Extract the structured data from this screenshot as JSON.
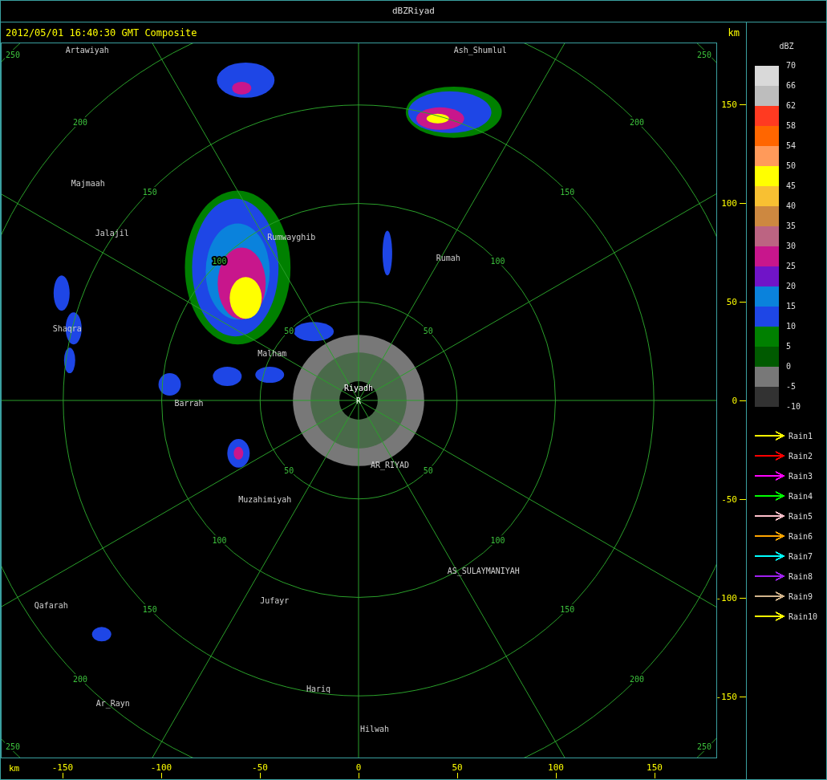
{
  "window": {
    "title": "dBZRiyad"
  },
  "header": {
    "timestamp": "2012/05/01 16:40:30 GMT Composite",
    "unit": "km"
  },
  "ppi": {
    "radar_site": {
      "name": "Riyadh",
      "marker": "R"
    },
    "range_rings": [
      {
        "labels": [
          "50",
          "50",
          "50",
          "50"
        ]
      },
      {
        "labels": [
          "100",
          "100",
          "100",
          "100"
        ]
      },
      {
        "labels": [
          "150",
          "150",
          "150",
          "150"
        ]
      },
      {
        "labels": [
          "200",
          "200",
          "200",
          "200"
        ]
      },
      {
        "labels": [
          "250",
          "250",
          "250",
          "250"
        ]
      }
    ],
    "places": [
      {
        "name": "Artawiyah"
      },
      {
        "name": "Ash_Shumlul"
      },
      {
        "name": "Majmaah"
      },
      {
        "name": "Jalajil"
      },
      {
        "name": "Rumwayghib"
      },
      {
        "name": "Rumah"
      },
      {
        "name": "Shaqra"
      },
      {
        "name": "Malham"
      },
      {
        "name": "Barrah"
      },
      {
        "name": "AR_RIYAD"
      },
      {
        "name": "Muzahimiyah"
      },
      {
        "name": "AS_SULAYMANIYAH"
      },
      {
        "name": "Jufayr"
      },
      {
        "name": "Qafarah"
      },
      {
        "name": "Hariq"
      },
      {
        "name": "Ar_Rayn"
      },
      {
        "name": "Hilwah"
      }
    ]
  },
  "x_axis": {
    "unit": "km",
    "ticks": [
      "-150",
      "-100",
      "-50",
      "0",
      "50",
      "100",
      "150"
    ]
  },
  "y_axis": {
    "ticks": [
      "150",
      "100",
      "50",
      "0",
      "-50",
      "-100",
      "-150"
    ]
  },
  "legend": {
    "title": "dBZ",
    "scale": [
      {
        "color": "#d9d9d9"
      },
      {
        "color": "#bdbdbd"
      },
      {
        "color": "#ff3a21"
      },
      {
        "color": "#ff6600"
      },
      {
        "color": "#ff9a5a"
      },
      {
        "color": "#ffff00"
      },
      {
        "color": "#f8c032"
      },
      {
        "color": "#cd8840"
      },
      {
        "color": "#bc6482"
      },
      {
        "color": "#c8168c"
      },
      {
        "color": "#7014c8"
      },
      {
        "color": "#0a82dc"
      },
      {
        "color": "#1e46e6"
      },
      {
        "color": "#008000"
      },
      {
        "color": "#005a00"
      },
      {
        "color": "#787878"
      },
      {
        "color": "#323232"
      }
    ],
    "labels": [
      "70",
      "66",
      "62",
      "58",
      "54",
      "50",
      "45",
      "40",
      "35",
      "30",
      "25",
      "20",
      "15",
      "10",
      "5",
      "0",
      "-5",
      "-10"
    ],
    "tracks": [
      {
        "name": "Rain1",
        "color": "#ffff00"
      },
      {
        "name": "Rain2",
        "color": "#ff0000"
      },
      {
        "name": "Rain3",
        "color": "#ff00ff"
      },
      {
        "name": "Rain4",
        "color": "#00ff00"
      },
      {
        "name": "Rain5",
        "color": "#ffc0cb"
      },
      {
        "name": "Rain6",
        "color": "#ffa500"
      },
      {
        "name": "Rain7",
        "color": "#00ffff"
      },
      {
        "name": "Rain8",
        "color": "#a020f0"
      },
      {
        "name": "Rain9",
        "color": "#d2b48c"
      },
      {
        "name": "Rain10",
        "color": "#ffff00"
      }
    ]
  }
}
